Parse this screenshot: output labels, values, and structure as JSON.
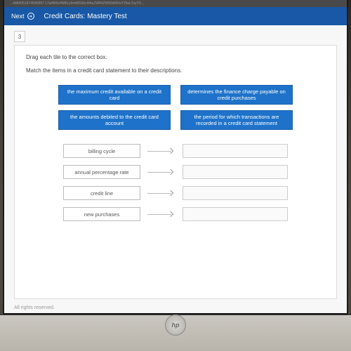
{
  "url_fragment": "...4884051874545897 17aHR0cHM6Ly9mMSShcHAuZWRtZW50dW0uY29sL2xyYX...",
  "header": {
    "next_label": "Next",
    "title": "Credit Cards: Mastery Test"
  },
  "question_number": "3",
  "instructions": {
    "line1": "Drag each tile to the correct box.",
    "line2": "Match the items in a credit card statement to their descriptions."
  },
  "tiles": [
    "the maximum credit available on a credit card",
    "determines the finance charge payable on credit purchases",
    "the amounts debited to the credit card account",
    "the period for which transactions are recorded in a credit card statement"
  ],
  "rows": [
    {
      "label": "billing cycle"
    },
    {
      "label": "annual percentage rate"
    },
    {
      "label": "credit line"
    },
    {
      "label": "new purchases"
    }
  ],
  "footer": "All rights reserved.",
  "laptop_brand": "hp"
}
